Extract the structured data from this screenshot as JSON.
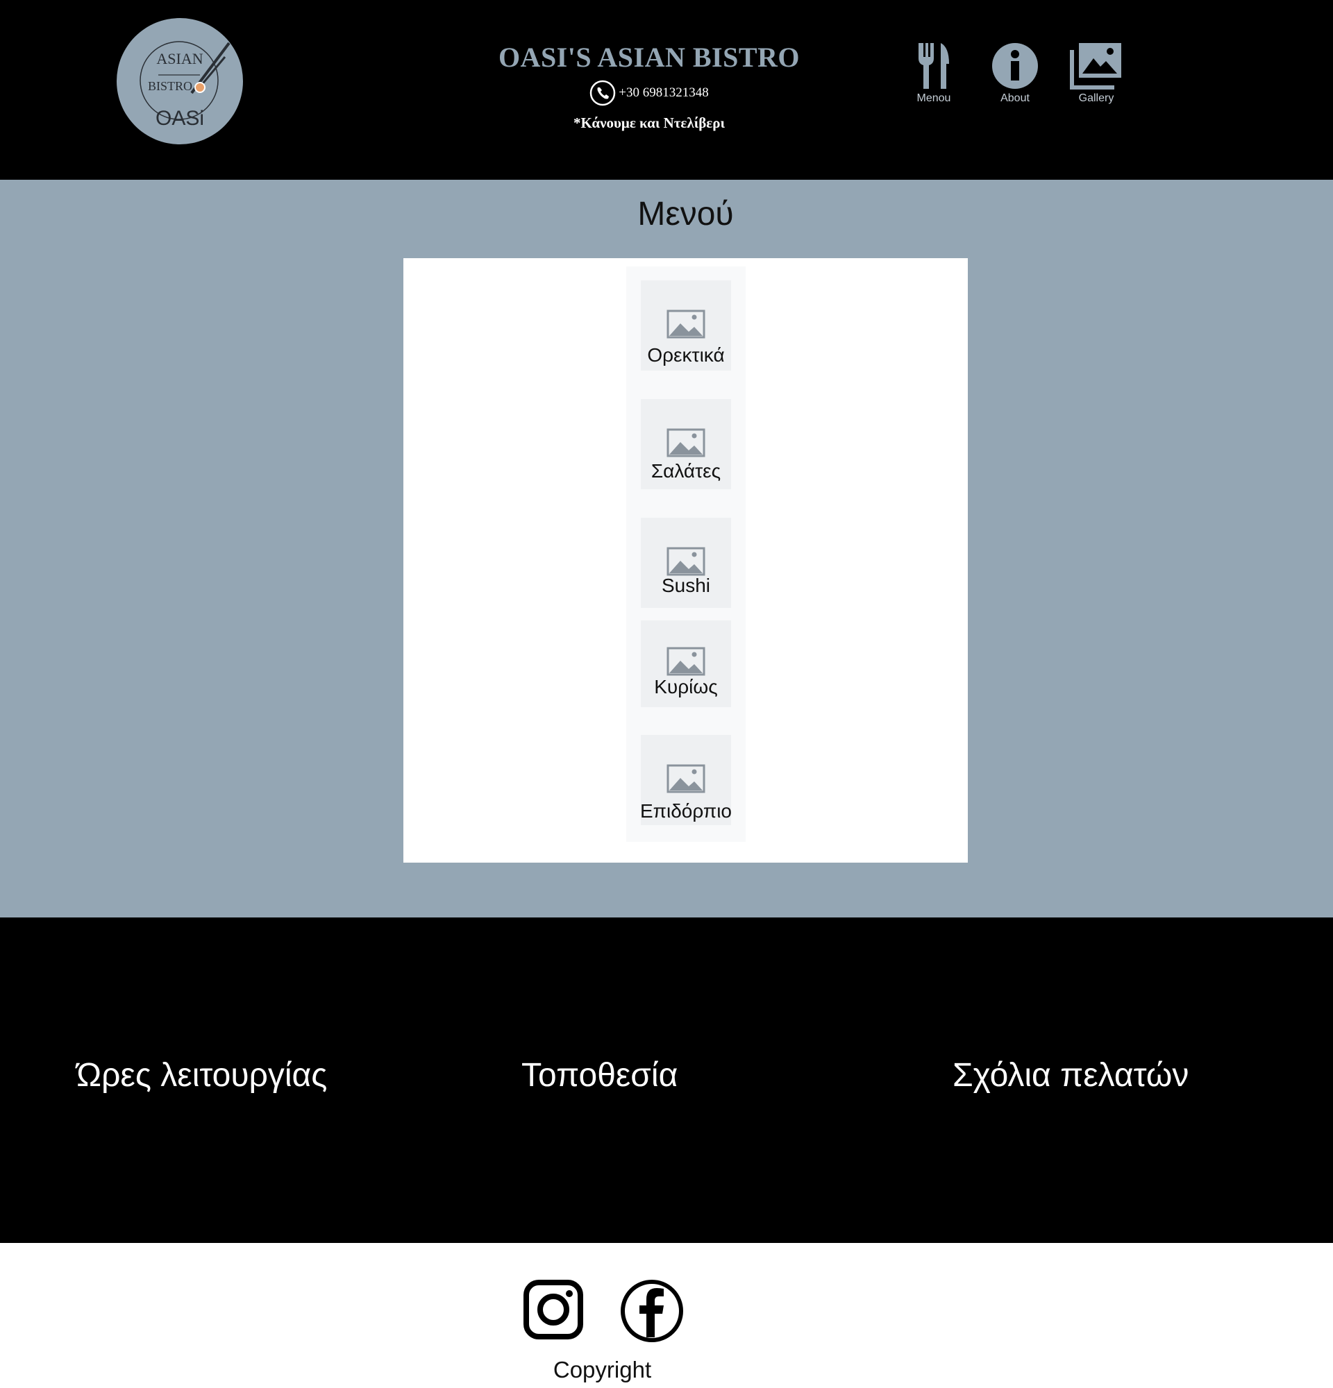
{
  "header": {
    "logo": {
      "line1": "ASIAN",
      "line2": "BISTRO",
      "line3": "OASi"
    },
    "brand_title": "OASI'S ASIAN BISTRO",
    "phone": "+30 6981321348",
    "delivery_note": "*Κάνουμε και Ντελίβερι",
    "nav": [
      {
        "label": "Menou",
        "icon": "fork-knife-icon"
      },
      {
        "label": "About",
        "icon": "info-icon"
      },
      {
        "label": "Gallery",
        "icon": "gallery-icon"
      }
    ]
  },
  "main": {
    "title": "Μενού",
    "categories": [
      {
        "label": "Ορεκτικά",
        "icon": "image-placeholder-icon"
      },
      {
        "label": "Σαλάτες",
        "icon": "image-placeholder-icon"
      },
      {
        "label": "Sushi",
        "icon": "image-placeholder-icon"
      },
      {
        "label": "Κυρίως",
        "icon": "image-placeholder-icon"
      },
      {
        "label": "Επιδόρπιο",
        "icon": "image-placeholder-icon"
      }
    ]
  },
  "footer": {
    "hours_heading": "Ώρες λειτουργίας",
    "location_heading": "Τοποθεσία",
    "reviews_heading": "Σχόλια πελατών"
  },
  "bottom": {
    "social": [
      {
        "icon": "instagram-icon"
      },
      {
        "icon": "facebook-icon"
      }
    ],
    "copyright": "Copyright"
  },
  "colors": {
    "header_bg": "#000000",
    "accent": "#94a6b4",
    "panel_bg": "#ffffff",
    "card_bg": "#eef0f2"
  }
}
